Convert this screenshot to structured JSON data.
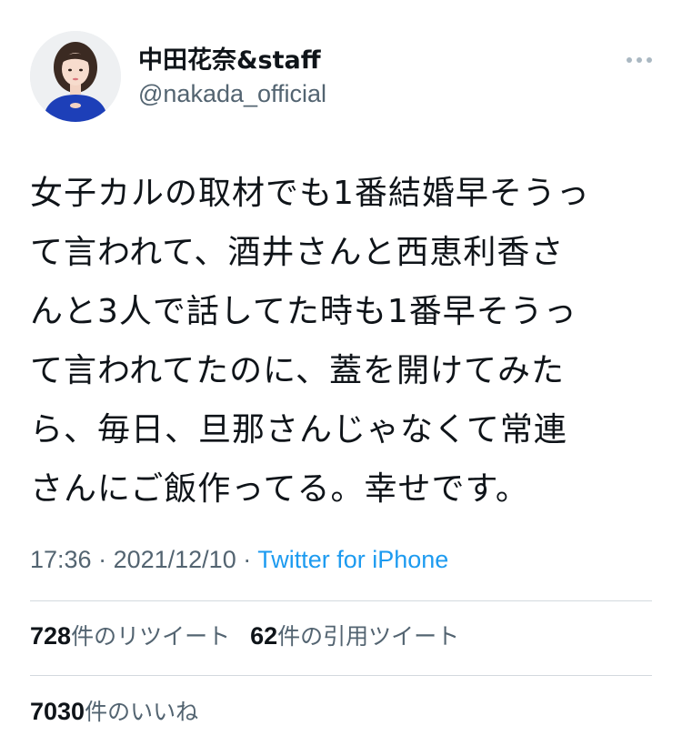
{
  "author": {
    "display_name": "中田花奈&staff",
    "handle": "@nakada_official"
  },
  "icons": {
    "avatar": "profile-photo",
    "more": "more-horizontal-icon"
  },
  "tweet": {
    "text": "女子カルの取材でも1番結婚早そうっ\nて言われて、酒井さんと西恵利香さ\nんと3人で話してた時も1番早そうっ\nて言われてたのに、蓋を開けてみた\nら、毎日、旦那さんじゃなくて常連\nさんにご飯作ってる。幸せです。",
    "time": "17:36",
    "separator1": " · ",
    "date": "2021/12/10",
    "separator2": " · ",
    "source": "Twitter for iPhone"
  },
  "stats": {
    "retweets": {
      "count": "728",
      "label": "件のリツイート"
    },
    "quotes": {
      "count": "62",
      "label": "件の引用ツイート"
    },
    "likes": {
      "count": "7030",
      "label": "件のいいね"
    }
  },
  "colors": {
    "text": "#0f1419",
    "secondary": "#536471",
    "link": "#1d9bf0",
    "divider": "#d3d9de"
  }
}
